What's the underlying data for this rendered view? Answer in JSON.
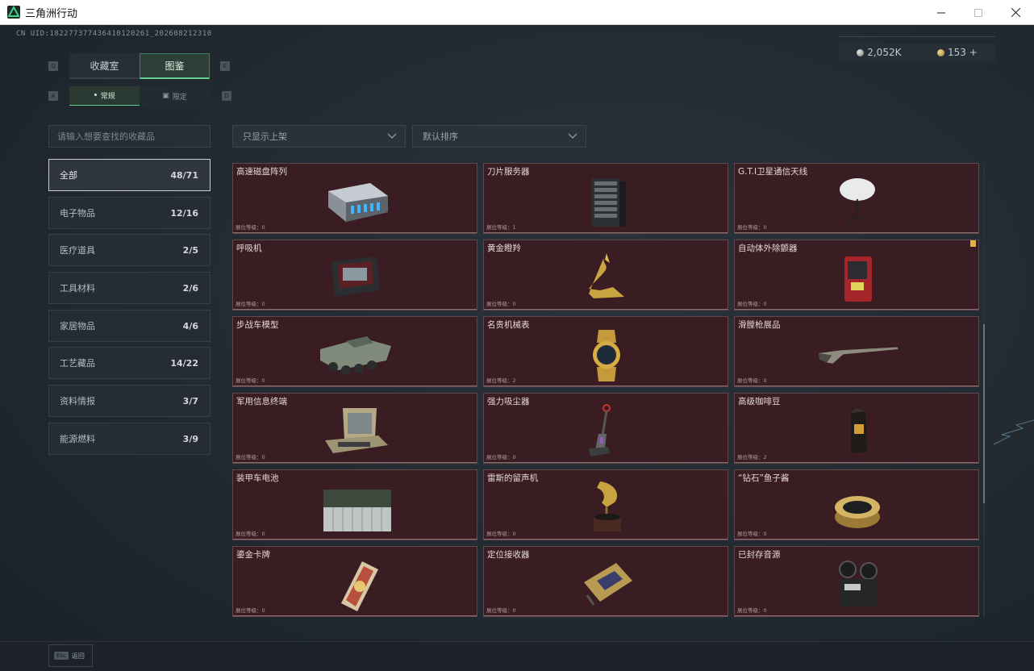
{
  "window": {
    "title": "三角洲行动"
  },
  "header": {
    "uid": "CN UID:18227737743641012026​1_202608212310",
    "currency": [
      {
        "icon": "silver-coin-icon",
        "value": "2,052K"
      },
      {
        "icon": "gold-coin-icon",
        "value": "153"
      }
    ],
    "add_label": "+"
  },
  "tabs": {
    "main": [
      {
        "label": "收藏室",
        "active": false
      },
      {
        "label": "图鉴",
        "active": true
      }
    ],
    "key_left": "Q",
    "key_right": "E",
    "sub": [
      {
        "label": "常规",
        "active": true
      },
      {
        "label": "限定",
        "active": false
      }
    ],
    "sub_key_left": "A",
    "sub_key_right": "D"
  },
  "search": {
    "placeholder": "请输入想要查找的收藏品"
  },
  "filters": {
    "show_filter": "只显示上架",
    "sort": "默认排序"
  },
  "categories": [
    {
      "label": "全部",
      "count": "48/71",
      "active": true
    },
    {
      "label": "电子物品",
      "count": "12/16"
    },
    {
      "label": "医疗道具",
      "count": "2/5"
    },
    {
      "label": "工具材料",
      "count": "2/6"
    },
    {
      "label": "家居物品",
      "count": "4/6"
    },
    {
      "label": "工艺藏品",
      "count": "14/22"
    },
    {
      "label": "资料情报",
      "count": "3/7"
    },
    {
      "label": "能源燃料",
      "count": "3/9"
    }
  ],
  "items": [
    {
      "name": "高速磁盘阵列",
      "level": "展位等级：0",
      "icon": "disk-array-icon"
    },
    {
      "name": "刀片服务器",
      "level": "展位等级：1",
      "icon": "blade-server-icon"
    },
    {
      "name": "G.T.I卫星通信天线",
      "level": "展位等级：0",
      "icon": "satellite-antenna-icon"
    },
    {
      "name": "呼吸机",
      "level": "展位等级：0",
      "icon": "ventilator-icon"
    },
    {
      "name": "黄金瞪羚",
      "level": "展位等级：0",
      "icon": "golden-gazelle-icon"
    },
    {
      "name": "自动体外除颤器",
      "level": "展位等级：0",
      "icon": "defibrillator-icon",
      "badge": true
    },
    {
      "name": "步战车模型",
      "level": "展位等级：0",
      "icon": "ifv-model-icon"
    },
    {
      "name": "名贵机械表",
      "level": "展位等级：2",
      "icon": "watch-icon"
    },
    {
      "name": "滑膛枪展品",
      "level": "展位等级：0",
      "icon": "musket-icon"
    },
    {
      "name": "军用信息终端",
      "level": "展位等级：0",
      "icon": "military-terminal-icon"
    },
    {
      "name": "强力吸尘器",
      "level": "展位等级：0",
      "icon": "vacuum-icon"
    },
    {
      "name": "高级咖啡豆",
      "level": "展位等级：2",
      "icon": "coffee-bag-icon"
    },
    {
      "name": "装甲车电池",
      "level": "展位等级：0",
      "icon": "battery-icon"
    },
    {
      "name": "雷斯的留声机",
      "level": "展位等级：0",
      "icon": "gramophone-icon"
    },
    {
      "name": "“钻石”鱼子酱",
      "level": "展位等级：0",
      "icon": "caviar-tin-icon"
    },
    {
      "name": "鎏金卡牌",
      "level": "展位等级：0",
      "icon": "gilded-card-icon"
    },
    {
      "name": "定位接收器",
      "level": "展位等级：0",
      "icon": "gps-receiver-icon"
    },
    {
      "name": "已封存音源",
      "level": "展位等级：0",
      "icon": "reel-recorder-icon"
    }
  ],
  "footer": {
    "esc_key": "Esc",
    "back_label": "返回"
  },
  "colors": {
    "card_bg": "#3a1d22",
    "accent_green": "#5fd18d",
    "badge": "#e2b43c"
  }
}
